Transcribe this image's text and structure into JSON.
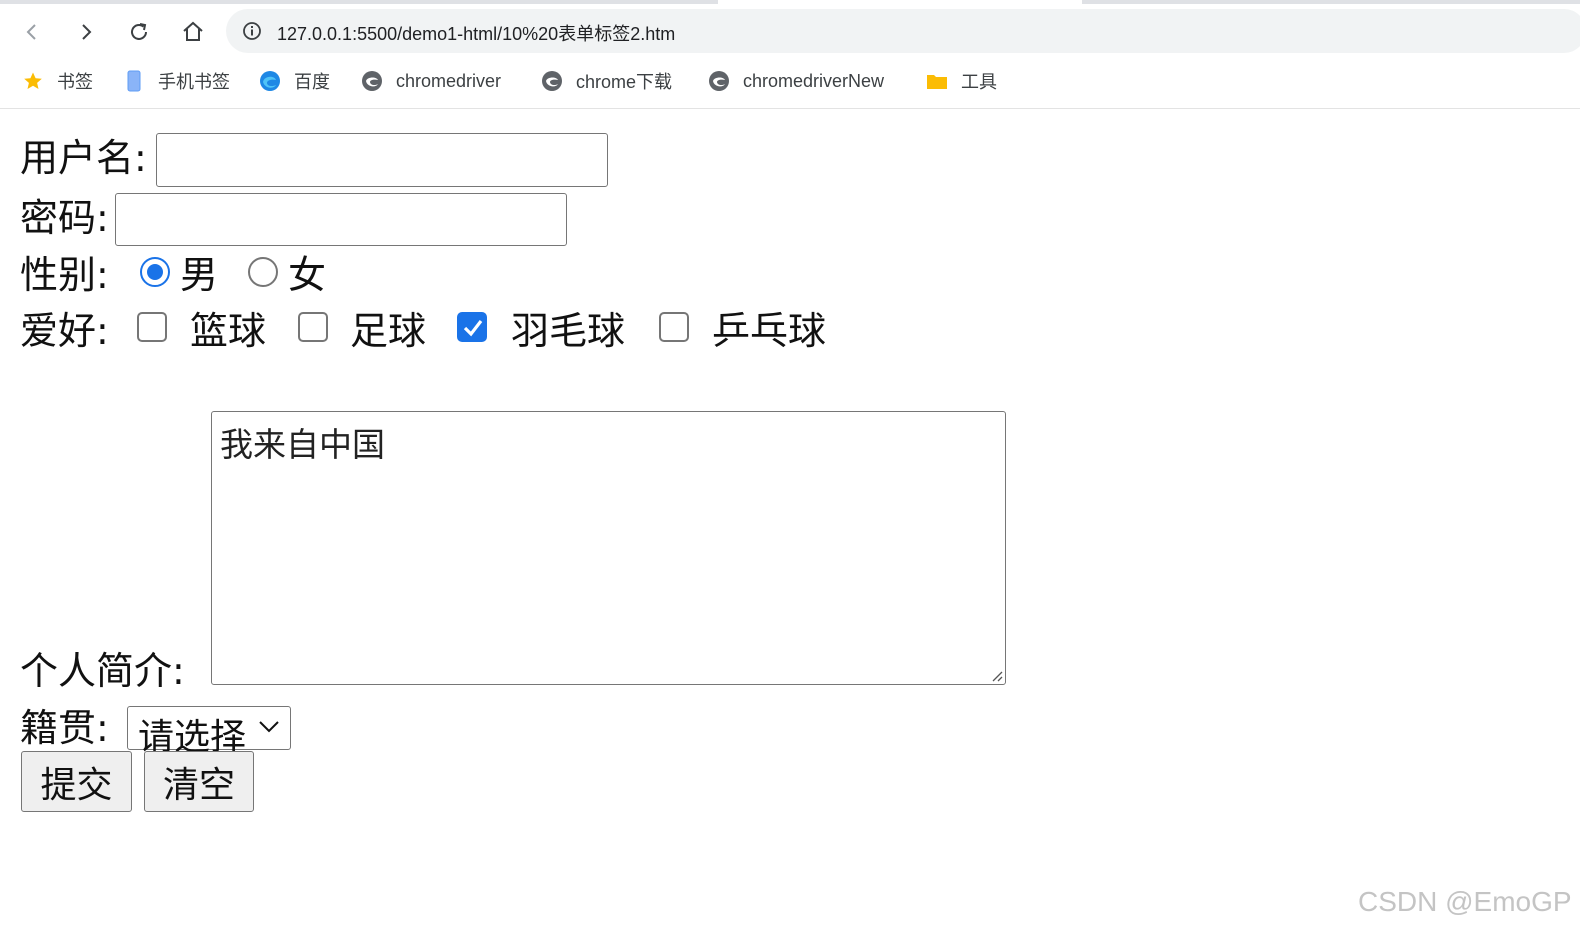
{
  "browser": {
    "url": "127.0.0.1:5500/demo1-html/10%20表单标签2.htm",
    "bookmarks": [
      {
        "label": "书签",
        "icon": "star-icon"
      },
      {
        "label": "手机书签",
        "icon": "phone-icon"
      },
      {
        "label": "百度",
        "icon": "edge-icon"
      },
      {
        "label": "chromedriver",
        "icon": "globe-icon"
      },
      {
        "label": "chrome下载",
        "icon": "globe-icon"
      },
      {
        "label": "chromedriverNew",
        "icon": "globe-icon"
      },
      {
        "label": "工具",
        "icon": "folder-icon"
      }
    ]
  },
  "form": {
    "username_label": "用户名:",
    "username_value": "",
    "password_label": "密码:",
    "password_value": "",
    "gender_label": "性别:",
    "gender_options": [
      {
        "label": "男",
        "checked": true
      },
      {
        "label": "女",
        "checked": false
      }
    ],
    "hobby_label": "爱好:",
    "hobbies": [
      {
        "label": "篮球",
        "checked": false
      },
      {
        "label": "足球",
        "checked": false
      },
      {
        "label": "羽毛球",
        "checked": true
      },
      {
        "label": "乒乓球",
        "checked": false
      }
    ],
    "intro_label": "个人简介:",
    "intro_value": "我来自中国",
    "hometown_label": "籍贯:",
    "hometown_selected": "请选择",
    "submit_label": "提交",
    "reset_label": "清空"
  },
  "colors": {
    "accent": "#1a73e8",
    "bookmark_star": "#fbbc04",
    "folder": "#fbbc04"
  },
  "watermark": "CSDN @EmoGP"
}
